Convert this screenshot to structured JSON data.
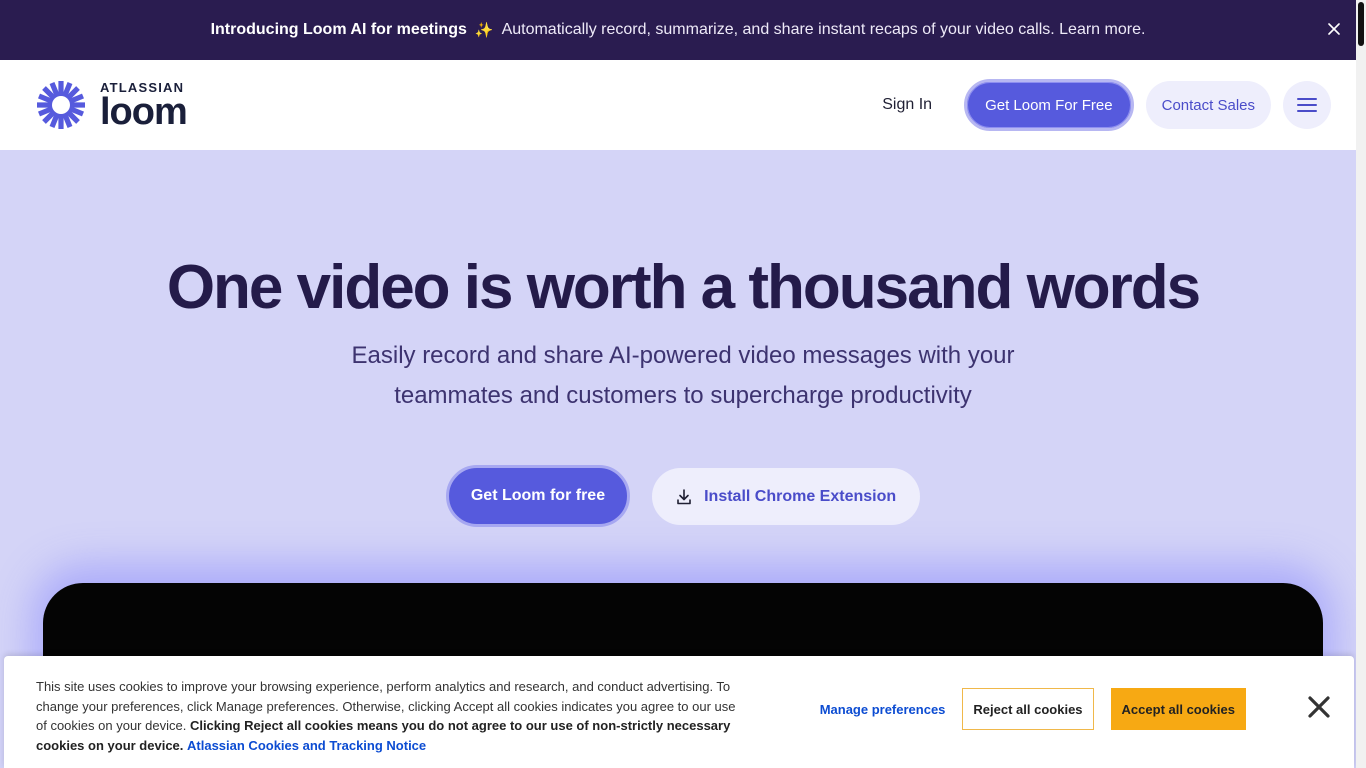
{
  "announcement": {
    "bold": "Introducing Loom AI for meetings",
    "sparkle": "✨",
    "text": "Automatically record, summarize, and share instant recaps of your video calls. Learn more.",
    "close_icon": "close-icon"
  },
  "logo": {
    "brand": "ATLASSIAN",
    "product": "loom",
    "icon": "loom-burst-icon",
    "color": "#565add"
  },
  "nav": {
    "sign_in": "Sign In",
    "primary": "Get Loom For Free",
    "secondary": "Contact Sales",
    "menu_icon": "hamburger-menu-icon"
  },
  "hero": {
    "title": "One video is worth a thousand words",
    "subtitle": "Easily record and share AI-powered video messages with your teammates and customers to supercharge productivity",
    "primary_cta": "Get Loom for free",
    "secondary_cta": "Install Chrome Extension",
    "secondary_icon": "download-icon"
  },
  "cookie": {
    "text": "This site uses cookies to improve your browsing experience, perform analytics and research, and conduct advertising. To change your preferences, click Manage preferences. Otherwise, clicking Accept all cookies indicates you agree to our use of cookies on your device.",
    "bold_text": "Clicking Reject all cookies means you do not agree to our use of non-strictly necessary cookies on your device.",
    "link": "Atlassian Cookies and Tracking Notice",
    "manage": "Manage preferences",
    "reject": "Reject all cookies",
    "accept": "Accept all cookies",
    "close_icon": "close-icon"
  },
  "colors": {
    "announcement_bg": "#2a1c50",
    "hero_bg": "#d4d4f7",
    "primary": "#565add",
    "title": "#241b4a",
    "accept": "#f7a913"
  }
}
